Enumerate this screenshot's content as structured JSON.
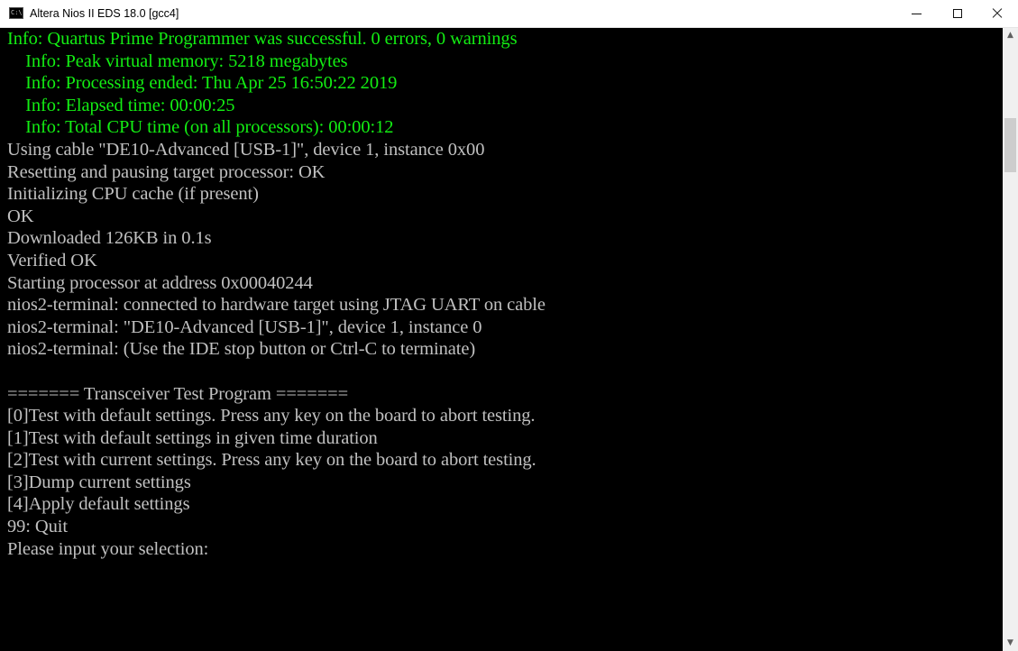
{
  "window": {
    "title": "Altera Nios II EDS 18.0 [gcc4]",
    "icon_label": "C:\\",
    "controls": {
      "minimize": "minimize-icon",
      "maximize": "maximize-icon",
      "close": "close-icon"
    }
  },
  "colors": {
    "background": "#000000",
    "default_text": "#c0c0c0",
    "info_text": "#13ed13",
    "titlebar": "#ffffff"
  },
  "console": {
    "lines": [
      {
        "text": "Info: Quartus Prime Programmer was successful. 0 errors, 0 warnings",
        "color": "green"
      },
      {
        "text": "    Info: Peak virtual memory: 5218 megabytes",
        "color": "green"
      },
      {
        "text": "    Info: Processing ended: Thu Apr 25 16:50:22 2019",
        "color": "green"
      },
      {
        "text": "    Info: Elapsed time: 00:00:25",
        "color": "green"
      },
      {
        "text": "    Info: Total CPU time (on all processors): 00:00:12",
        "color": "green"
      },
      {
        "text": "Using cable \"DE10-Advanced [USB-1]\", device 1, instance 0x00",
        "color": "default"
      },
      {
        "text": "Resetting and pausing target processor: OK",
        "color": "default"
      },
      {
        "text": "Initializing CPU cache (if present)",
        "color": "default"
      },
      {
        "text": "OK",
        "color": "default"
      },
      {
        "text": "Downloaded 126KB in 0.1s",
        "color": "default"
      },
      {
        "text": "Verified OK",
        "color": "default"
      },
      {
        "text": "Starting processor at address 0x00040244",
        "color": "default"
      },
      {
        "text": "nios2-terminal: connected to hardware target using JTAG UART on cable",
        "color": "default"
      },
      {
        "text": "nios2-terminal: \"DE10-Advanced [USB-1]\", device 1, instance 0",
        "color": "default"
      },
      {
        "text": "nios2-terminal: (Use the IDE stop button or Ctrl-C to terminate)",
        "color": "default"
      },
      {
        "text": "",
        "color": "default"
      },
      {
        "text": "======= Transceiver Test Program =======",
        "color": "default"
      },
      {
        "text": "[0]Test with default settings. Press any key on the board to abort testing.",
        "color": "default"
      },
      {
        "text": "[1]Test with default settings in given time duration",
        "color": "default"
      },
      {
        "text": "[2]Test with current settings. Press any key on the board to abort testing.",
        "color": "default"
      },
      {
        "text": "[3]Dump current settings",
        "color": "default"
      },
      {
        "text": "[4]Apply default settings",
        "color": "default"
      },
      {
        "text": "99: Quit",
        "color": "default"
      },
      {
        "text": "Please input your selection:",
        "color": "default"
      }
    ]
  },
  "scrollbar": {
    "up_icon": "chevron-up-icon",
    "down_icon": "chevron-down-icon"
  }
}
